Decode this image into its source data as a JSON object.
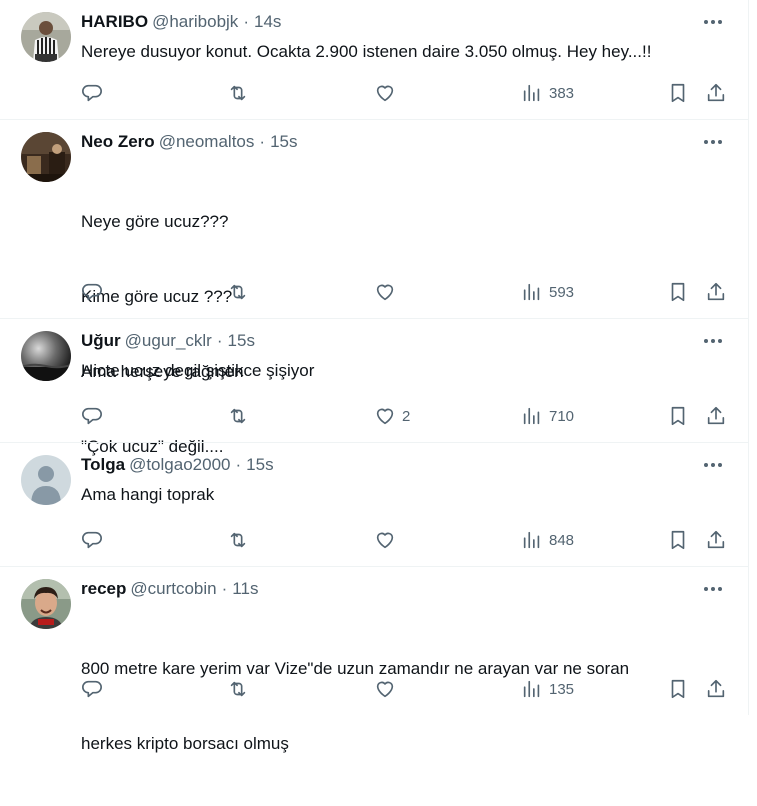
{
  "tweets": [
    {
      "name": "HARIBO",
      "handle": "@haribobjk",
      "dot": "·",
      "time": "14s",
      "lines": [
        "Nereye dusuyor konut. Ocakta 2.900 istenen daire 3.050 olmuş. Hey hey...!!"
      ],
      "likes": "",
      "views": "383",
      "avatar": "person-with-football-shirt"
    },
    {
      "name": "Neo Zero",
      "handle": "@neomaltos",
      "dot": "·",
      "time": "15s",
      "lines": [
        "Neye göre ucuz???",
        "Kime göre ucuz ???",
        "Ama herşeye rağmen",
        "\"Çok ucuz\" değil...."
      ],
      "likes": "",
      "views": "593",
      "avatar": "dark-photo"
    },
    {
      "name": "Uğur",
      "handle": "@ugur_cklr",
      "dot": "·",
      "time": "15s",
      "lines": [
        "Hicte ucuz degil şiştikce şişiyor"
      ],
      "likes": "2",
      "views": "710",
      "avatar": "stormy-sky"
    },
    {
      "name": "Tolga",
      "handle": "@tolgao2000",
      "dot": "·",
      "time": "15s",
      "lines": [
        "Ama hangi toprak"
      ],
      "likes": "",
      "views": "848",
      "avatar": "default-user"
    },
    {
      "name": "recep",
      "handle": "@curtcobin",
      "dot": "·",
      "time": "11s",
      "lines": [
        "800 metre kare yerim var Vize\"de uzun zamandır ne arayan var ne soran",
        "herkes kripto borsacı olmuş"
      ],
      "likes": "",
      "views": "135",
      "avatar": "man-portrait"
    }
  ],
  "icons": {
    "reply": "reply-icon",
    "retweet": "retweet-icon",
    "like": "heart-icon",
    "views": "views-chart-icon",
    "bookmark": "bookmark-icon",
    "share": "share-icon",
    "more": "more-dots-icon"
  },
  "colors": {
    "text": "#0f1419",
    "muted": "#536471",
    "border": "#eff3f4"
  }
}
